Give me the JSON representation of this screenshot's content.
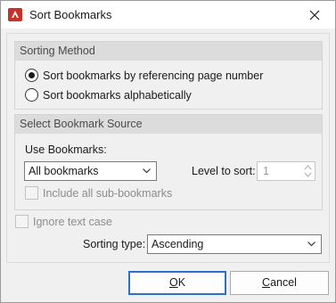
{
  "window": {
    "title": "Sort Bookmarks",
    "accent_color": "#c8302a"
  },
  "sorting_method": {
    "header": "Sorting Method",
    "options": [
      {
        "label": "Sort bookmarks by referencing page number",
        "checked": true
      },
      {
        "label": "Sort bookmarks alphabetically",
        "checked": false
      }
    ]
  },
  "bookmark_source": {
    "header": "Select Bookmark Source",
    "use_bookmarks_label": "Use Bookmarks:",
    "use_bookmarks_value": "All bookmarks",
    "level_label": "Level to sort:",
    "level_value": "1",
    "include_sub_label": "Include all sub-bookmarks"
  },
  "options": {
    "ignore_case_label": "Ignore text case",
    "sorting_type_label": "Sorting type:",
    "sorting_type_value": "Ascending"
  },
  "buttons": {
    "ok_mnemonic": "O",
    "ok_rest": "K",
    "cancel_mnemonic": "C",
    "cancel_rest": "ancel"
  },
  "icons": {
    "app": "pdf-editor-icon",
    "close": "close-icon",
    "dropdown": "chevron-down-icon",
    "spin": "spin-arrows-icon"
  }
}
